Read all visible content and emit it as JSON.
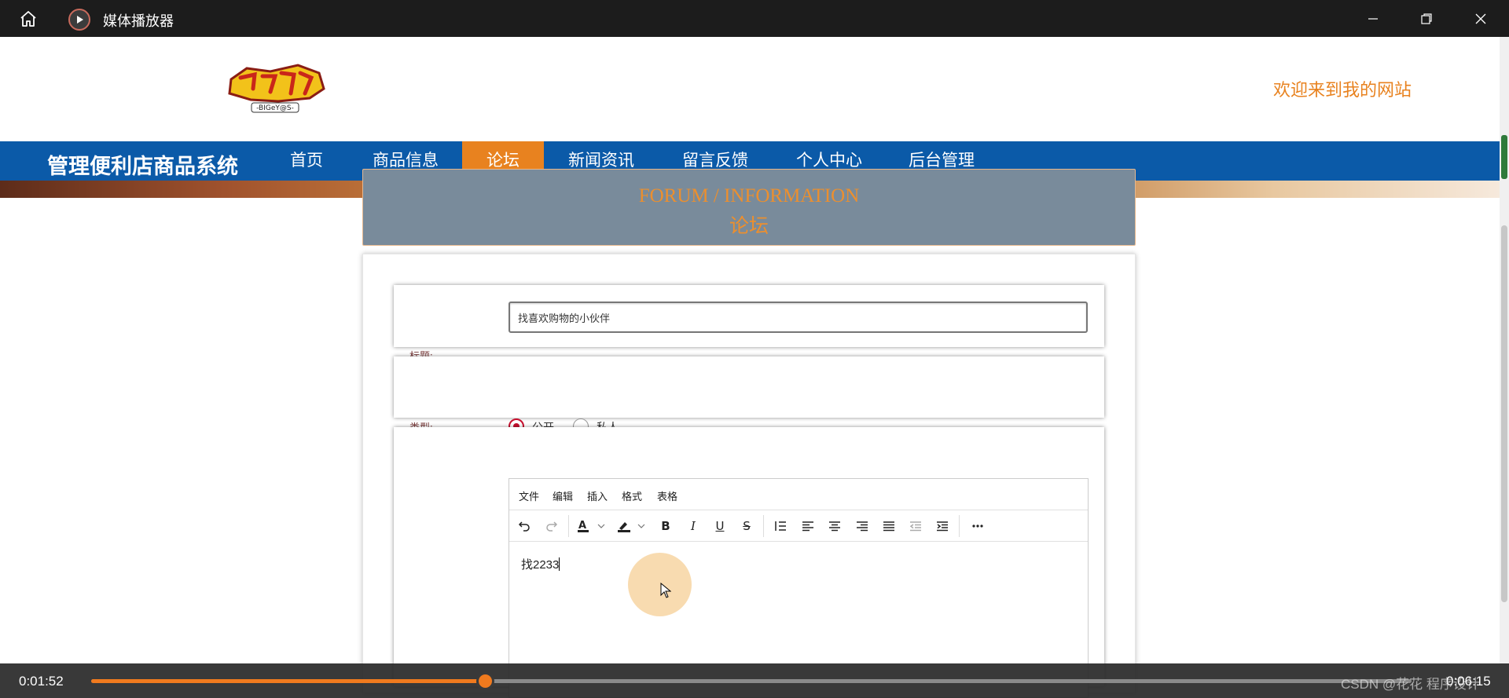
{
  "player": {
    "title": "媒体播放器",
    "current_time": "0:01:52",
    "total_time": "0:06:15",
    "progress_fraction": 0.298,
    "watermark": "CSDN @花花 程序设计"
  },
  "site": {
    "welcome": "欢迎来到我的网站",
    "logo_text": "-BIGeY@S-",
    "brand": "管理便利店商品系统",
    "nav": [
      {
        "label": "首页",
        "active": false
      },
      {
        "label": "商品信息",
        "active": false
      },
      {
        "label": "论坛",
        "active": true
      },
      {
        "label": "新闻资讯",
        "active": false
      },
      {
        "label": "留言反馈",
        "active": false
      },
      {
        "label": "个人中心",
        "active": false
      },
      {
        "label": "后台管理",
        "active": false
      }
    ],
    "panel": {
      "title_en": "FORUM / INFORMATION",
      "title_cn": "论坛"
    },
    "form": {
      "title_label": "标题:",
      "title_value": "找喜欢购物的小伙伴",
      "type_label": "类型:",
      "type_options": [
        {
          "label": "公开",
          "checked": true
        },
        {
          "label": "私人",
          "checked": false
        }
      ],
      "editor": {
        "menu": [
          "文件",
          "编辑",
          "插入",
          "格式",
          "表格"
        ],
        "content": "找2233",
        "tools": [
          "undo-icon",
          "redo-icon",
          "text-color-icon",
          "highlight-color-icon",
          "bold-icon",
          "italic-icon",
          "underline-icon",
          "strikethrough-icon",
          "line-height-icon",
          "align-left-icon",
          "align-center-icon",
          "align-right-icon",
          "align-justify-icon",
          "outdent-icon",
          "indent-icon",
          "more-icon"
        ]
      }
    }
  },
  "colors": {
    "accent": "#e8821f",
    "nav_bg": "#0b5aa8",
    "panel_bg": "#798b9b",
    "progress": "#f07a1e"
  }
}
